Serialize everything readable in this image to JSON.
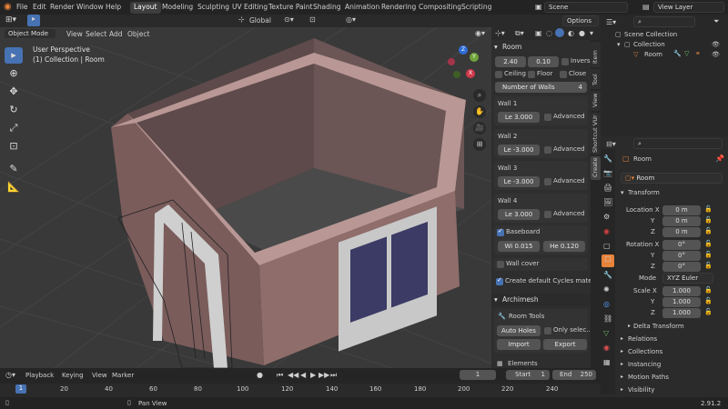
{
  "menu": {
    "file": "File",
    "edit": "Edit",
    "render": "Render",
    "window": "Window",
    "help": "Help"
  },
  "workspaces": [
    "Layout",
    "Modeling",
    "Sculpting",
    "UV Editing",
    "Texture Paint",
    "Shading",
    "Animation",
    "Rendering",
    "Compositing",
    "Scripting"
  ],
  "scene": {
    "label": "Scene",
    "view_layer": "View Layer"
  },
  "viewport_header": {
    "transform_orientation": "Global",
    "options": "Options",
    "mode": "Object Mode",
    "view": "View",
    "select": "Select",
    "add": "Add",
    "object": "Object"
  },
  "viewport": {
    "perspective": "User Perspective",
    "collection": "(1) Collection | Room"
  },
  "gizmo": {
    "x": "X",
    "y": "Y",
    "z": "Z"
  },
  "npanel": {
    "room_title": "Room",
    "height": "2.40",
    "thickness": "0.10",
    "inverse": "Invers",
    "ceiling": "Ceiling",
    "floor": "Floor",
    "close": "Close",
    "num_walls_label": "Number of Walls",
    "num_walls": "4",
    "walls": [
      {
        "title": "Wall 1",
        "length": "Le   3.000",
        "advanced": "Advanced"
      },
      {
        "title": "Wall 2",
        "length": "Le  -3.000",
        "advanced": "Advanced"
      },
      {
        "title": "Wall 3",
        "length": "Le  -3.000",
        "advanced": "Advanced"
      },
      {
        "title": "Wall 4",
        "length": "Le   3.000",
        "advanced": "Advanced"
      }
    ],
    "baseboard": "Baseboard",
    "base_width": "Wi   0.015",
    "base_height": "He   0.120",
    "wall_cover": "Wall cover",
    "cycles": "Create default Cycles materi...",
    "archimesh": "Archimesh",
    "room_tools": "Room Tools",
    "auto_holes": "Auto Holes",
    "only_selected": "Only selec...",
    "import": "Import",
    "export": "Export",
    "elements": "Elements"
  },
  "vtabs": [
    "Item",
    "Tool",
    "View",
    "Shortcut VUr",
    "Create"
  ],
  "outliner": {
    "scene_collection": "Scene Collection",
    "collection": "Collection",
    "room": "Room"
  },
  "props": {
    "object_name": "Room",
    "data_name": "Room",
    "transform": "Transform",
    "location_x_label": "Location X",
    "loc_x": "0 m",
    "loc_y": "0 m",
    "loc_z": "0 m",
    "rotation_x_label": "Rotation X",
    "rot_x": "0°",
    "rot_y": "0°",
    "rot_z": "0°",
    "mode_label": "Mode",
    "mode": "XYZ Euler",
    "scale_x_label": "Scale X",
    "scale_x": "1.000",
    "scale_y": "1.000",
    "scale_z": "1.000",
    "y": "Y",
    "z": "Z",
    "delta": "Delta Transform",
    "relations": "Relations",
    "collections": "Collections",
    "instancing": "Instancing",
    "motion_paths": "Motion Paths",
    "visibility": "Visibility"
  },
  "timeline": {
    "playback": "Playback",
    "keying": "Keying",
    "view": "View",
    "marker": "Marker",
    "current": "1",
    "start_label": "Start",
    "start": "1",
    "end_label": "End",
    "end": "250",
    "ticks": [
      "1",
      "20",
      "40",
      "60",
      "80",
      "100",
      "120",
      "140",
      "160",
      "180",
      "200",
      "220",
      "240"
    ]
  },
  "status": {
    "pan": "Pan View",
    "version": "2.91.2"
  },
  "colors": {
    "accent": "#4772b3",
    "room": "#7a5c5b",
    "orange": "#e8833a"
  }
}
